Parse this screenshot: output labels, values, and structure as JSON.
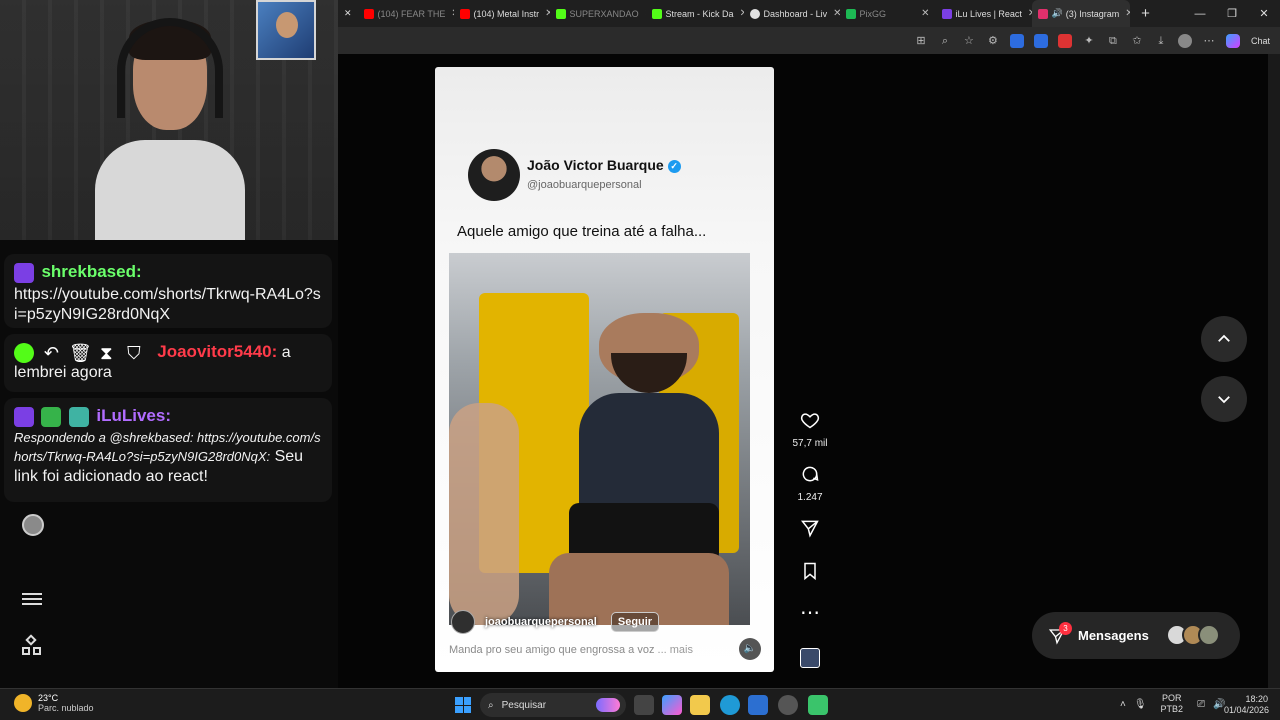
{
  "stream_chat": {
    "messages": [
      {
        "user": "shrekbased:",
        "user_color": "#6bff6b",
        "text": "https://youtube.com/shorts/Tkrwq-RA4Lo?si=p5zyN9IG28rd0NqX"
      },
      {
        "user": "Joaovitor5440:",
        "user_color": "#ff3b4a",
        "text": "a lembrei agora"
      },
      {
        "user": "iLuLives:",
        "user_color": "#b16cff",
        "reply_prefix": "Respondendo a @shrekbased: https://youtube.com/shorts/Tkrwq-RA4Lo?si=p5zyN9IG28rd0NqX:",
        "text": "Seu link foi adicionado ao react!"
      }
    ]
  },
  "browser": {
    "tabs": [
      {
        "label": "(104) FEAR THE",
        "fav_color": "#ff0000",
        "active": false
      },
      {
        "label": "(104) Metal Instr",
        "fav_color": "#ff0000",
        "active": false
      },
      {
        "label": "SUPERXANDAO",
        "fav_color": "#53fc18",
        "active": false
      },
      {
        "label": "Stream - Kick Da",
        "fav_color": "#53fc18",
        "active": false
      },
      {
        "label": "Dashboard - Liv",
        "fav_color": "#e0e0e0",
        "active": false
      },
      {
        "label": "PixGG",
        "fav_color": "#1db954",
        "active": false
      },
      {
        "label": "iLu Lives | React",
        "fav_color": "#7b3fe4",
        "active": false
      },
      {
        "label": "(3) Instagram",
        "fav_color": "#e1306c",
        "active": true
      }
    ],
    "chat_label": "Chat"
  },
  "reel": {
    "author_name": "João Victor Buarque",
    "author_handle": "@joaobuarquepersonal",
    "caption": "Aquele amigo que treina até a falha...",
    "video_username": "joaobuarquepersonal",
    "follow_label": "Seguir",
    "sub_caption": "Manda pro seu amigo que engrossa a voz",
    "more_label": "... mais",
    "likes": "57,7 mil",
    "comments": "1.247"
  },
  "messages_button": {
    "label": "Mensagens",
    "badge": "3"
  },
  "taskbar": {
    "temperature": "23°C",
    "condition": "Parc. nublado",
    "search_placeholder": "Pesquisar",
    "lang_top": "POR",
    "lang_bottom": "PTB2",
    "time": "18:20",
    "date": "01/04/2026"
  }
}
